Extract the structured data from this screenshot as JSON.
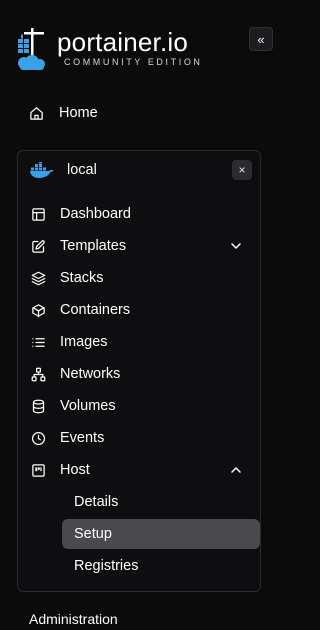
{
  "brand": {
    "title": "portainer.io",
    "subtitle": "COMMUNITY EDITION",
    "logo_icon": "portainer-logo-icon",
    "accent_color": "#3ba1e6"
  },
  "collapse_button": {
    "label": "«",
    "icon": "chevrons-left-icon"
  },
  "home": {
    "label": "Home",
    "icon": "home-icon"
  },
  "environment": {
    "name": "local",
    "icon": "docker-icon",
    "close_label": "×",
    "items": [
      {
        "label": "Dashboard",
        "icon": "dashboard-icon"
      },
      {
        "label": "Templates",
        "icon": "edit-icon",
        "expandable": true,
        "expanded": false
      },
      {
        "label": "Stacks",
        "icon": "layers-icon"
      },
      {
        "label": "Containers",
        "icon": "box-icon"
      },
      {
        "label": "Images",
        "icon": "list-icon"
      },
      {
        "label": "Networks",
        "icon": "network-icon"
      },
      {
        "label": "Volumes",
        "icon": "database-icon"
      },
      {
        "label": "Events",
        "icon": "clock-icon"
      },
      {
        "label": "Host",
        "icon": "host-icon",
        "expandable": true,
        "expanded": true
      }
    ],
    "host_subitems": [
      {
        "label": "Details",
        "active": false
      },
      {
        "label": "Setup",
        "active": true
      },
      {
        "label": "Registries",
        "active": false
      }
    ]
  },
  "administration": {
    "label": "Administration"
  },
  "colors": {
    "background": "#0b0b0c",
    "active_item": "#4a4a4e",
    "border": "#2a2a2e"
  }
}
